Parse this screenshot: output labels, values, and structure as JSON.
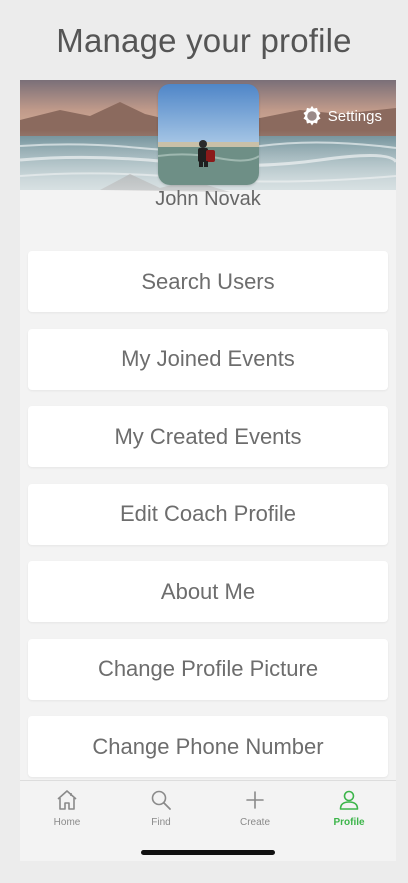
{
  "page": {
    "title": "Manage your profile"
  },
  "profile": {
    "name": "John Novak",
    "settings_label": "Settings"
  },
  "menu": {
    "items": [
      {
        "label": "Search Users"
      },
      {
        "label": "My Joined Events"
      },
      {
        "label": "My Created Events"
      },
      {
        "label": "Edit Coach Profile"
      },
      {
        "label": "About Me"
      },
      {
        "label": "Change Profile Picture"
      },
      {
        "label": "Change Phone Number"
      }
    ]
  },
  "tabbar": {
    "tabs": [
      {
        "label": "Home",
        "icon": "home-icon",
        "active": false
      },
      {
        "label": "Find",
        "icon": "search-icon",
        "active": false
      },
      {
        "label": "Create",
        "icon": "plus-icon",
        "active": false
      },
      {
        "label": "Profile",
        "icon": "person-icon",
        "active": true
      }
    ]
  },
  "colors": {
    "accent": "#3cb54a",
    "text": "#6d6d6d",
    "background": "#ececec"
  }
}
